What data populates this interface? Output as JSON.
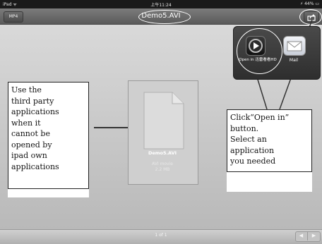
{
  "status_bar": {
    "carrier": "iPad ᯤ",
    "time": "上午11:24",
    "battery": "⚡ 44% ▭"
  },
  "nav": {
    "back_label": "MP4",
    "title": "Demo5.AVI"
  },
  "file": {
    "name": "Demo5.AVI",
    "type": "AVI movie",
    "size": "2.2 MB"
  },
  "popover": {
    "app_label": "Open in 迅雷看看HD",
    "mail_label": "Mail"
  },
  "annotations": {
    "left": "Use the\nthird party\napplications\nwhen it\ncannot be\nopened by\nipad own\napplications",
    "right": "Click“Open in”\nbutton.\nSelect an\napplication\nyou needed"
  },
  "bottom": {
    "page_indicator": "1 of 1",
    "prev": "◀",
    "next": "▶"
  },
  "colors": {
    "nav_bg": "#6a6a6a",
    "content_bg": "#cccccc",
    "highlight": "#ffffff"
  }
}
